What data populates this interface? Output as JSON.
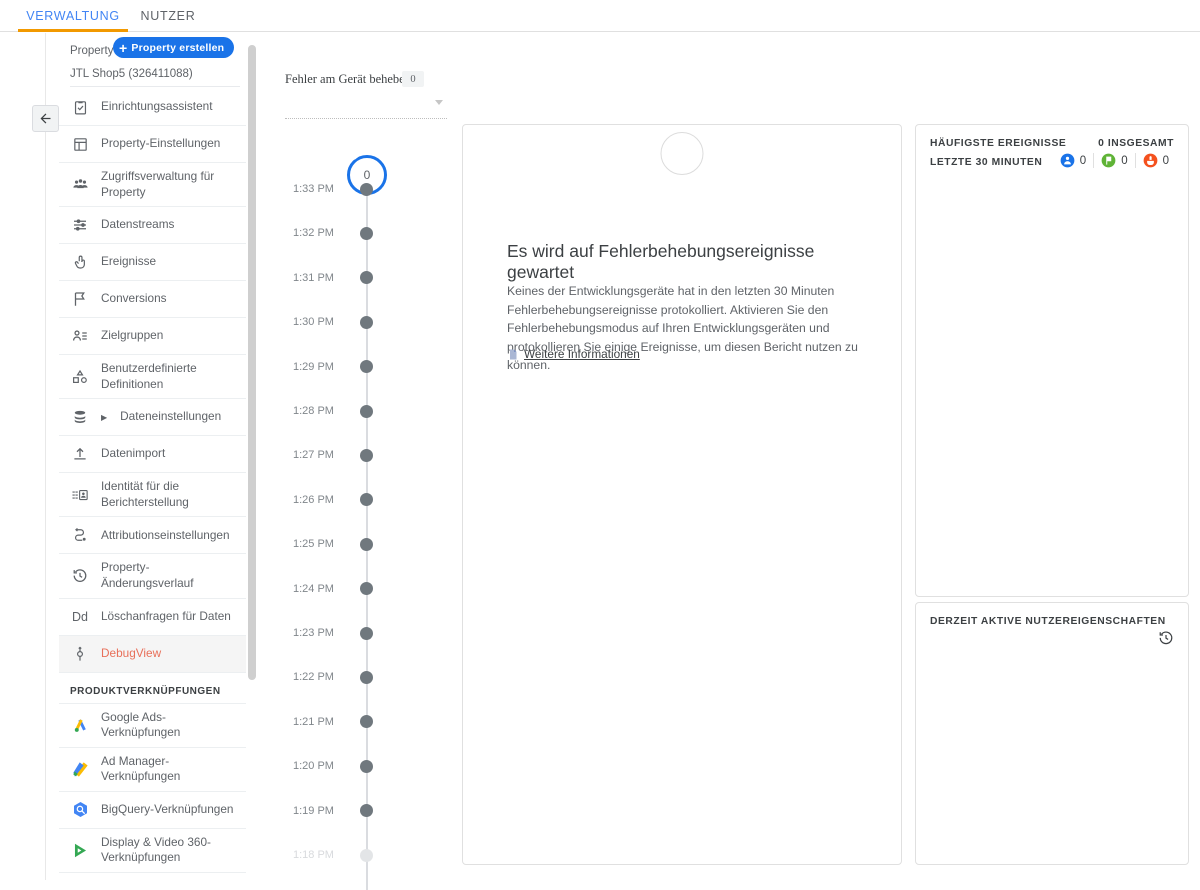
{
  "tabs": [
    {
      "label": "VERWALTUNG",
      "active": true
    },
    {
      "label": "NUTZER",
      "active": false
    }
  ],
  "sidebar": {
    "property_label": "Property",
    "create_button": "Property erstellen",
    "property_name": "JTL Shop5 (326411088)",
    "items": [
      {
        "label": "Einrichtungsassistent",
        "icon": "clipboard-check-icon"
      },
      {
        "label": "Property-Einstellungen",
        "icon": "layout-icon"
      },
      {
        "label": "Zugriffsverwaltung für Property",
        "icon": "people-icon"
      },
      {
        "label": "Datenstreams",
        "icon": "sliders-icon"
      },
      {
        "label": "Ereignisse",
        "icon": "tap-icon"
      },
      {
        "label": "Conversions",
        "icon": "flag-icon"
      },
      {
        "label": "Zielgruppen",
        "icon": "audience-icon"
      },
      {
        "label": "Benutzerdefinierte Definitionen",
        "icon": "shapes-icon"
      },
      {
        "label": "Dateneinstellungen",
        "icon": "database-icon",
        "expandable": true
      },
      {
        "label": "Datenimport",
        "icon": "upload-icon"
      },
      {
        "label": "Identität für die Berichterstellung",
        "icon": "id-card-icon"
      },
      {
        "label": "Attributionseinstellungen",
        "icon": "attribution-icon"
      },
      {
        "label": "Property-Änderungsverlauf",
        "icon": "history-icon"
      },
      {
        "label": "Löschanfragen für Daten",
        "icon": "dd-text-icon"
      },
      {
        "label": "DebugView",
        "icon": "debug-icon",
        "selected": true
      }
    ],
    "section_title": "PRODUKTVERKNÜPFUNGEN",
    "product_links": [
      {
        "label": "Google Ads-Verknüpfungen",
        "icon": "google-ads-icon"
      },
      {
        "label": "Ad Manager-Verknüpfungen",
        "icon": "ad-manager-icon"
      },
      {
        "label": "BigQuery-Verknüpfungen",
        "icon": "bigquery-icon"
      },
      {
        "label": "Display & Video 360-Verknüpfungen",
        "icon": "dv360-icon"
      }
    ]
  },
  "timeline": {
    "title": "Fehler am Gerät beheben",
    "count": "0",
    "device_placeholder": "",
    "current_value": "0",
    "entries": [
      {
        "time": "1:33 PM",
        "faded": false
      },
      {
        "time": "1:32 PM",
        "faded": false
      },
      {
        "time": "1:31 PM",
        "faded": false
      },
      {
        "time": "1:30 PM",
        "faded": false
      },
      {
        "time": "1:29 PM",
        "faded": false
      },
      {
        "time": "1:28 PM",
        "faded": false
      },
      {
        "time": "1:27 PM",
        "faded": false
      },
      {
        "time": "1:26 PM",
        "faded": false
      },
      {
        "time": "1:25 PM",
        "faded": false
      },
      {
        "time": "1:24 PM",
        "faded": false
      },
      {
        "time": "1:23 PM",
        "faded": false
      },
      {
        "time": "1:22 PM",
        "faded": false
      },
      {
        "time": "1:21 PM",
        "faded": false
      },
      {
        "time": "1:20 PM",
        "faded": false
      },
      {
        "time": "1:19 PM",
        "faded": false
      },
      {
        "time": "1:18 PM",
        "faded": true
      }
    ]
  },
  "main": {
    "empty_title": "Es wird auf Fehlerbehebungsereignisse gewartet",
    "empty_body": "Keines der Entwicklungsgeräte hat in den letzten 30 Minuten Fehlerbehebungsereignisse protokolliert. Aktivieren Sie den Fehlerbehebungsmodus auf Ihren Entwicklungsgeräten und protokollieren Sie einige Ereignisse, um diesen Bericht nutzen zu können.",
    "learn_more": "Weitere Informationen"
  },
  "right": {
    "top_events": {
      "title": "HÄUFIGSTE EREIGNISSE",
      "total": "0 INSGESAMT",
      "subtitle": "LETZTE 30 MINUTEN",
      "badges": [
        {
          "icon": "user-badge-icon",
          "color": "#1a73e8",
          "value": "0"
        },
        {
          "icon": "flag-badge-icon",
          "color": "#5fb336",
          "value": "0"
        },
        {
          "icon": "event-badge-icon",
          "color": "#f4511e",
          "value": "0"
        }
      ]
    },
    "user_props": {
      "title": "DERZEIT AKTIVE NUTZEREIGENSCHAFTEN",
      "icon": "history-clock-icon"
    }
  },
  "colors": {
    "accent_blue": "#1a73e8",
    "tab_underline": "#f29900",
    "selected_item": "#e8705a"
  }
}
